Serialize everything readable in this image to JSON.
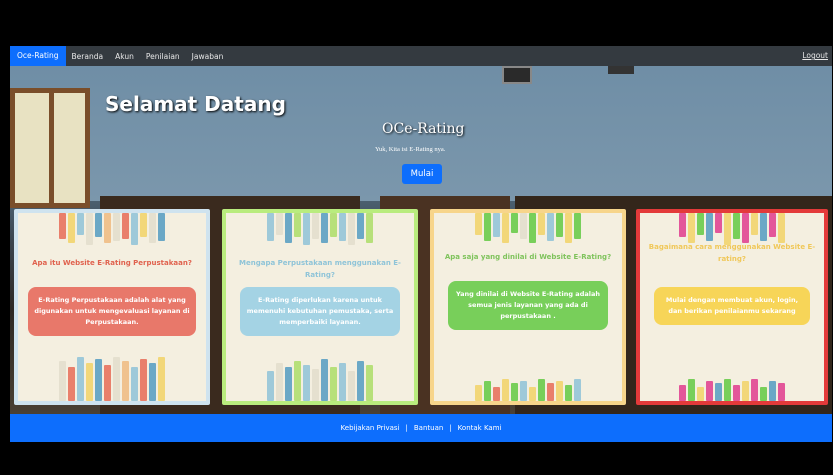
{
  "nav": {
    "brand": "Oce-Rating",
    "items": [
      "Beranda",
      "Akun",
      "Penilaian",
      "Jawaban"
    ],
    "logout": "Logout"
  },
  "hero": {
    "welcome": "Selamat Datang",
    "title": "OCe-Rating",
    "subtitle": "Yuk, Kita isi E-Rating nya.",
    "button": "Mulai"
  },
  "cards": [
    {
      "question": "Apa itu Website E-Rating Perpustakaan?",
      "answer": "E-Rating Perpustakaan adalah alat yang digunakan untuk mengevaluasi layanan di Perpustakaan.",
      "accent": "#e8786a",
      "border": "#cfe3ef"
    },
    {
      "question": "Mengapa Perpustakaan menggunakan E-Rating?",
      "answer": "E-Rating diperlukan karena untuk memenuhi kebutuhan pemustaka, serta memperbaiki layanan.",
      "accent": "#a4d3e4",
      "border": "#b9ec7e"
    },
    {
      "question": "Apa saja yang dinilai di Website E-Rating?",
      "answer": "Yang dinilai di Website E-Rating adalah semua jenis layanan yang ada di perpustakaan .",
      "accent": "#78cf5a",
      "border": "#f7d58b"
    },
    {
      "question": "Bagaimana cara menggunakan Website E-rating?",
      "answer": "Mulai dengan membuat akun, login, dan berikan penilaianmu sekarang",
      "accent": "#f7d558",
      "border": "#e33a3a"
    }
  ],
  "footer": {
    "links": [
      "Kebijakan Privasi",
      "Bantuan",
      "Kontak Kami"
    ],
    "separator": "|"
  }
}
